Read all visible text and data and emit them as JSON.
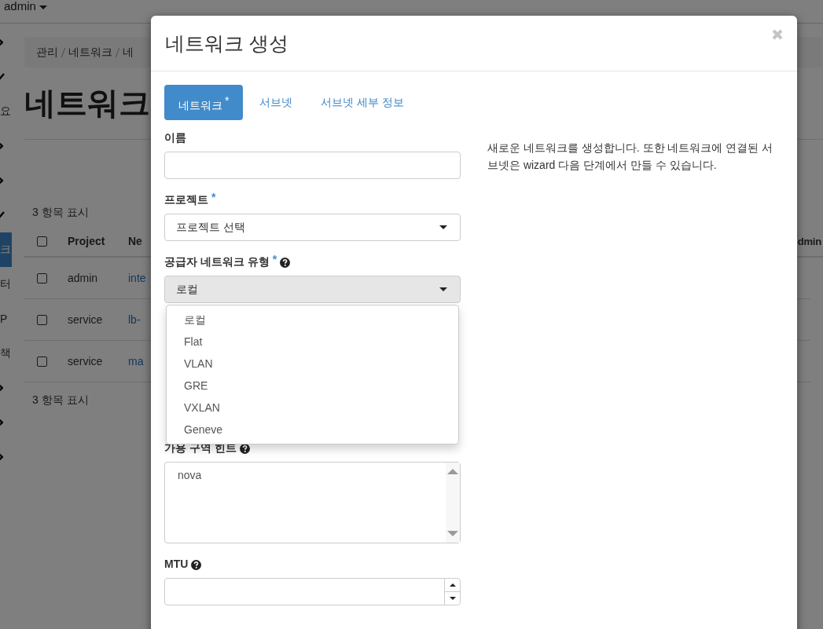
{
  "top_bar": {
    "user": "admin"
  },
  "sidebar": {
    "items": [
      {
        "kind": "chevron"
      },
      {
        "kind": "check"
      },
      {
        "kind": "text",
        "label": "요",
        "selected": false
      },
      {
        "kind": "chevron"
      },
      {
        "kind": "chevron"
      },
      {
        "kind": "check"
      },
      {
        "kind": "text",
        "label": "크",
        "selected": true
      },
      {
        "kind": "text",
        "label": "터",
        "selected": false
      },
      {
        "kind": "text",
        "label": "P",
        "selected": false
      },
      {
        "kind": "text",
        "label": "책",
        "selected": false
      },
      {
        "kind": "chevron"
      },
      {
        "kind": "chevron"
      },
      {
        "kind": "chevron"
      }
    ]
  },
  "breadcrumb": [
    "관리",
    "네트워크",
    "네"
  ],
  "page_title": "네트워크",
  "table": {
    "count_top": "3 항목 표시",
    "select_all_checked": false,
    "columns": [
      "Project",
      "Ne",
      "dmin"
    ],
    "rows": [
      {
        "checked": false,
        "project": "admin",
        "network": "inte"
      },
      {
        "checked": false,
        "project": "service",
        "network": "lb-"
      },
      {
        "checked": false,
        "project": "service",
        "network": "ma"
      }
    ],
    "count_bottom": "3 항목 표시"
  },
  "modal": {
    "title": "네트워크 생성",
    "tabs": [
      {
        "label": "네트워크",
        "mark": "*",
        "selected": true
      },
      {
        "label": "서브넷",
        "selected": false
      },
      {
        "label": "서브넷 세부 정보",
        "selected": false
      }
    ],
    "fields": [
      {
        "kind": "text",
        "label": "이름"
      },
      {
        "kind": "select",
        "label": "프로젝트",
        "mark": "*",
        "value": "프로젝트 선택",
        "open": false
      },
      {
        "kind": "select",
        "label": "공급자 네트워크 유형",
        "mark": "*",
        "help": true,
        "value": "로컬",
        "open": true,
        "options": [
          "로컬",
          "Flat",
          "VLAN",
          "GRE",
          "VXLAN",
          "Geneve"
        ]
      },
      {
        "kind": "listbox",
        "label": "가용 구역 힌트",
        "help": true,
        "options": [
          "nova"
        ]
      },
      {
        "kind": "number",
        "label": "MTU",
        "help": true
      }
    ],
    "description": "새로운 네트워크를 생성합니다. 또한 네트워크에 연결된 서브넷은 wizard 다음 단계에서 만들 수 있습니다."
  }
}
